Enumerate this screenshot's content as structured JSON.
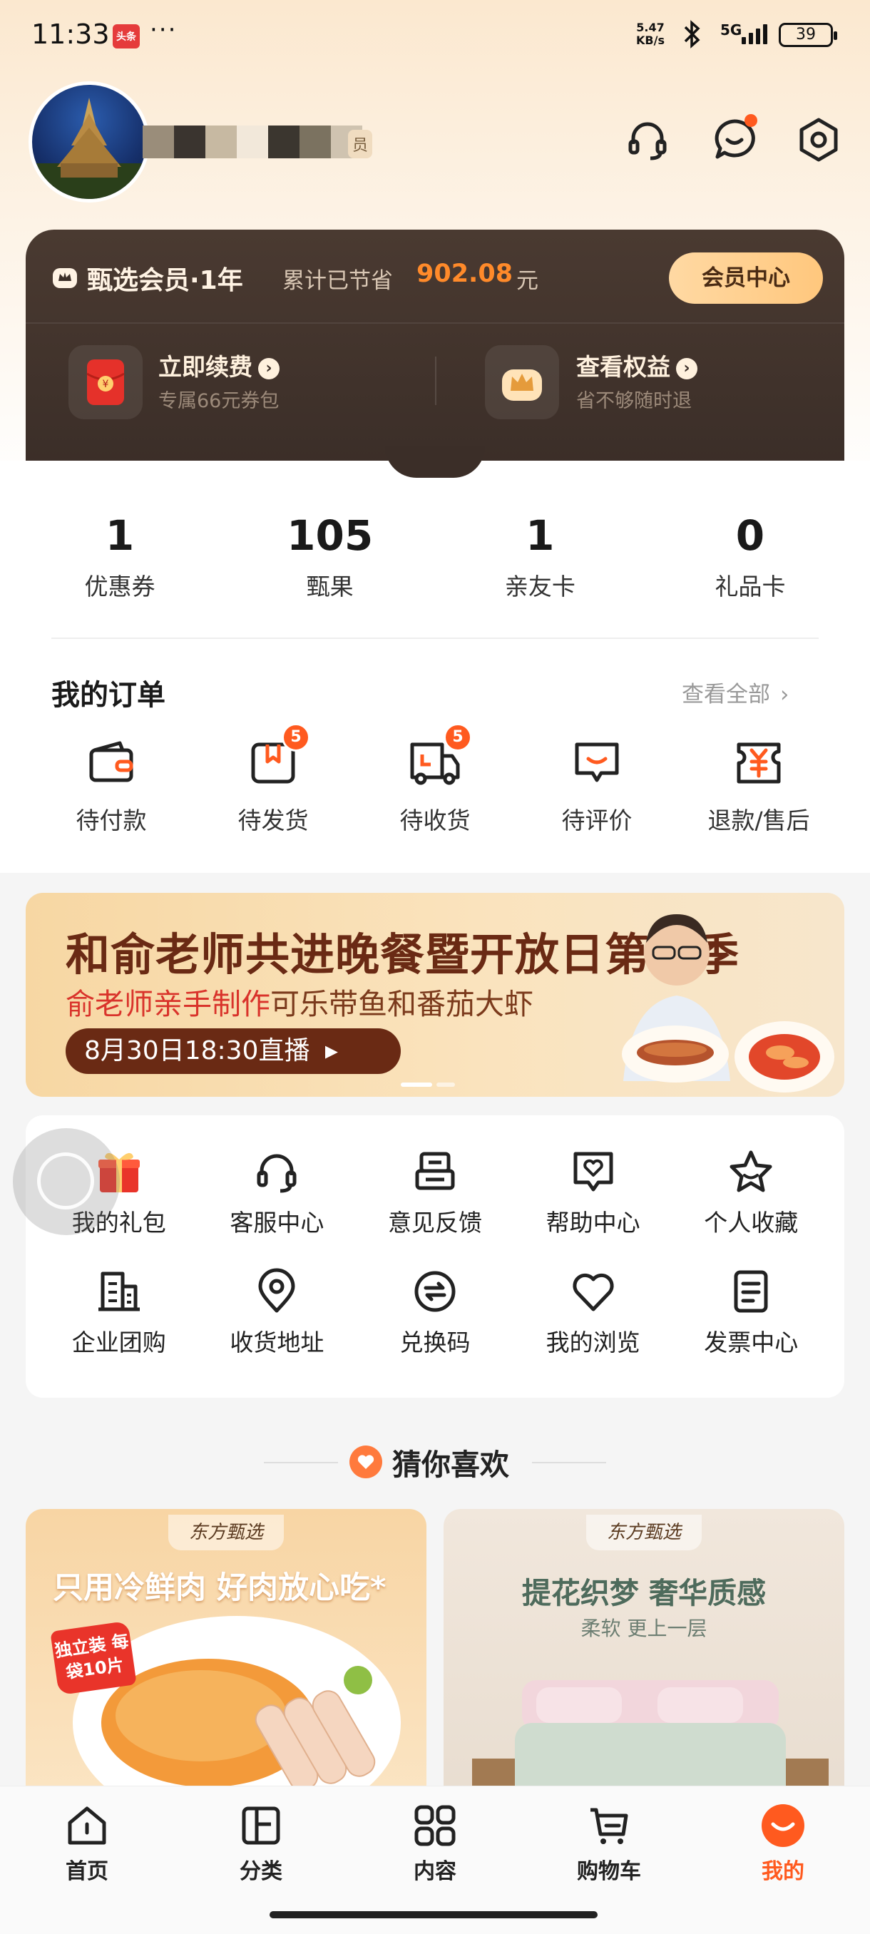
{
  "status_bar": {
    "time": "11:33",
    "app_badge": "头条",
    "dots": "···",
    "net_speed_top": "5.47",
    "net_speed_unit": "KB/s",
    "network": "5G",
    "battery": "39"
  },
  "profile": {
    "member_suffix": "员"
  },
  "membership": {
    "title": "甄选会员·1年",
    "saved_label": "累计已节省",
    "saved_value": "902.08",
    "saved_unit": "元",
    "center_button": "会员中心",
    "renew_title": "立即续费",
    "renew_sub": "专属66元券包",
    "benefits_title": "查看权益",
    "benefits_sub": "省不够随时退"
  },
  "stats": [
    {
      "value": "1",
      "label": "优惠券"
    },
    {
      "value": "105",
      "label": "甄果"
    },
    {
      "value": "1",
      "label": "亲友卡"
    },
    {
      "value": "0",
      "label": "礼品卡"
    }
  ],
  "orders": {
    "title": "我的订单",
    "view_all": "查看全部",
    "items": [
      {
        "label": "待付款",
        "icon": "wallet-icon",
        "badge": ""
      },
      {
        "label": "待发货",
        "icon": "package-icon",
        "badge": "5"
      },
      {
        "label": "待收货",
        "icon": "truck-icon",
        "badge": "5"
      },
      {
        "label": "待评价",
        "icon": "comment-icon",
        "badge": ""
      },
      {
        "label": "退款/售后",
        "icon": "refund-icon",
        "badge": ""
      }
    ]
  },
  "banner": {
    "title": "和俞老师共进晚餐暨开放日第三季",
    "sub_red": "俞老师亲手制作",
    "sub_rest": "可乐带鱼和番茄大虾",
    "live": "8月30日18:30直播"
  },
  "services": [
    {
      "label": "我的礼包",
      "icon": "gift-icon"
    },
    {
      "label": "客服中心",
      "icon": "headset-icon"
    },
    {
      "label": "意见反馈",
      "icon": "feedback-icon"
    },
    {
      "label": "帮助中心",
      "icon": "help-heart-icon"
    },
    {
      "label": "个人收藏",
      "icon": "star-icon"
    },
    {
      "label": "企业团购",
      "icon": "building-icon"
    },
    {
      "label": "收货地址",
      "icon": "location-icon"
    },
    {
      "label": "兑换码",
      "icon": "exchange-icon"
    },
    {
      "label": "我的浏览",
      "icon": "heart-icon"
    },
    {
      "label": "发票中心",
      "icon": "invoice-icon"
    }
  ],
  "guess": {
    "title": "猜你喜欢",
    "cards": [
      {
        "brand": "东方甄选",
        "title": "只用冷鲜肉 好肉放心吃*",
        "tag": "独立装 每袋10片"
      },
      {
        "brand": "东方甄选",
        "title": "提花织梦 奢华质感",
        "sub": "柔软 更上一层"
      }
    ]
  },
  "nav": [
    {
      "label": "首页",
      "icon": "home-icon"
    },
    {
      "label": "分类",
      "icon": "category-icon"
    },
    {
      "label": "内容",
      "icon": "content-grid-icon"
    },
    {
      "label": "购物车",
      "icon": "cart-icon"
    },
    {
      "label": "我的",
      "icon": "profile-icon",
      "active": true
    }
  ],
  "colors": {
    "accent": "#ff5a1f",
    "member_dark": "#3b2e28",
    "gold": "#ffc77d"
  }
}
